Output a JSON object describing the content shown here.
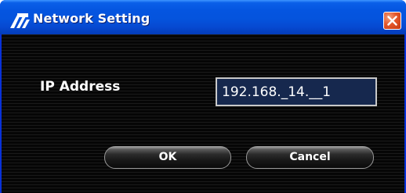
{
  "window": {
    "title": "Network Setting",
    "app_icon": "network-app-icon",
    "close_icon": "close-icon",
    "close_color": "#e3562a",
    "titlebar_color": "#0555e0"
  },
  "form": {
    "ip_label": "IP Address",
    "ip_value": "192.168._14.__1"
  },
  "buttons": {
    "ok_label": "OK",
    "cancel_label": "Cancel"
  }
}
